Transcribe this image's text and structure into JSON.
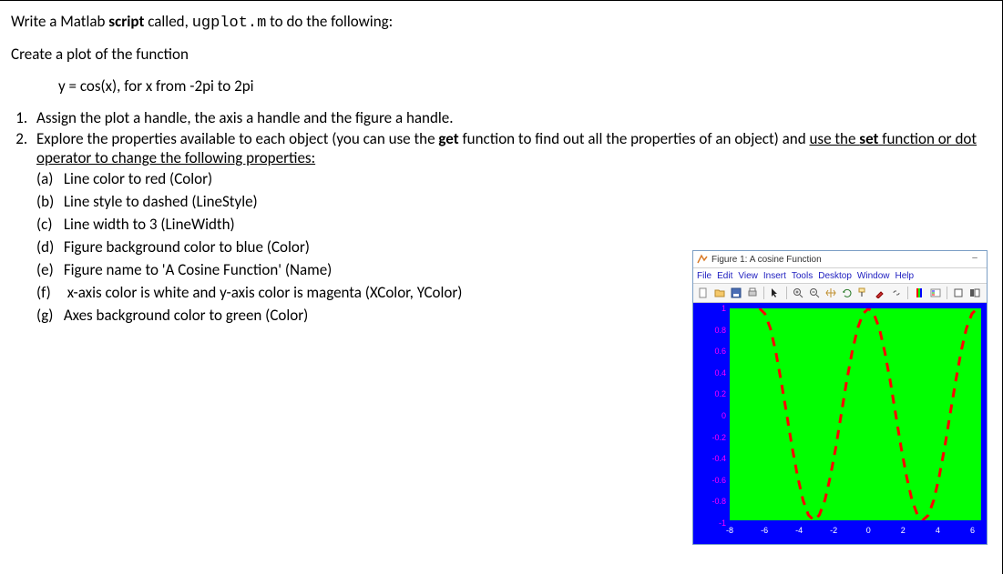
{
  "intro1_a": "Write a Matlab ",
  "intro1_b": "script",
  "intro1_c": " called, ",
  "intro1_code": "ugplot.m",
  "intro1_d": " to do the following:",
  "intro2": "Create a plot of the function",
  "func": "y = cos(x), for x from -2pi to 2pi",
  "step1": "Assign the plot a handle, the axis a handle and the figure a handle.",
  "step2_a": "Explore the properties available to each object (you can use the ",
  "step2_b": "get",
  "step2_c": " function to find out all the properties of an object) and ",
  "step2_u1": "use the ",
  "step2_u2": "set",
  "step2_u3": " function or dot operator to change the following properties:",
  "props": {
    "a": "Line color to red (Color)",
    "b": "Line style to dashed (LineStyle)",
    "c": "Line width to 3 (LineWidth)",
    "d": "Figure background color to blue (Color)",
    "e": "Figure name to 'A Cosine Function' (Name)",
    "f": "x-axis color is white and y-axis color is magenta (XColor, YColor)",
    "g": "Axes background color to green  (Color)"
  },
  "figwin": {
    "title": "Figure 1: A cosine Function",
    "menus": [
      "File",
      "Edit",
      "View",
      "Insert",
      "Tools",
      "Desktop",
      "Window",
      "Help"
    ],
    "yticks": [
      "1",
      "0.8",
      "0.6",
      "0.4",
      "0.2",
      "0",
      "-0.2",
      "-0.4",
      "-0.6",
      "-0.8",
      "-1"
    ],
    "xticks": [
      "-8",
      "-6",
      "-4",
      "-2",
      "0",
      "2",
      "4",
      "6"
    ]
  },
  "chart_data": {
    "type": "line",
    "title": "A cosine Function",
    "xlabel": "",
    "ylabel": "",
    "xlim": [
      -8,
      6.5
    ],
    "ylim": [
      -1,
      1
    ],
    "x": [
      -6.28,
      -5.97,
      -5.65,
      -5.34,
      -5.03,
      -4.71,
      -4.4,
      -4.08,
      -3.77,
      -3.46,
      -3.14,
      -2.83,
      -2.51,
      -2.2,
      -1.88,
      -1.57,
      -1.26,
      -0.94,
      -0.63,
      -0.31,
      0.0,
      0.31,
      0.63,
      0.94,
      1.26,
      1.57,
      1.88,
      2.2,
      2.51,
      2.83,
      3.14,
      3.46,
      3.77,
      4.08,
      4.4,
      4.71,
      5.03,
      5.34,
      5.65,
      5.97,
      6.28
    ],
    "y": [
      1.0,
      0.95,
      0.81,
      0.59,
      0.31,
      0.0,
      -0.31,
      -0.59,
      -0.81,
      -0.95,
      -1.0,
      -0.95,
      -0.81,
      -0.59,
      -0.31,
      0.0,
      0.31,
      0.59,
      0.81,
      0.95,
      1.0,
      0.95,
      0.81,
      0.59,
      0.31,
      0.0,
      -0.31,
      -0.59,
      -0.81,
      -0.95,
      -1.0,
      -0.95,
      -0.81,
      -0.59,
      -0.31,
      0.0,
      0.31,
      0.59,
      0.81,
      0.95,
      1.0
    ],
    "line_color": "#ff0000",
    "line_style": "dashed",
    "line_width": 3,
    "axes_bg": "#00ff00",
    "figure_bg": "#0000ff",
    "xcolor": "#ffffff",
    "ycolor": "#ff00ff"
  }
}
